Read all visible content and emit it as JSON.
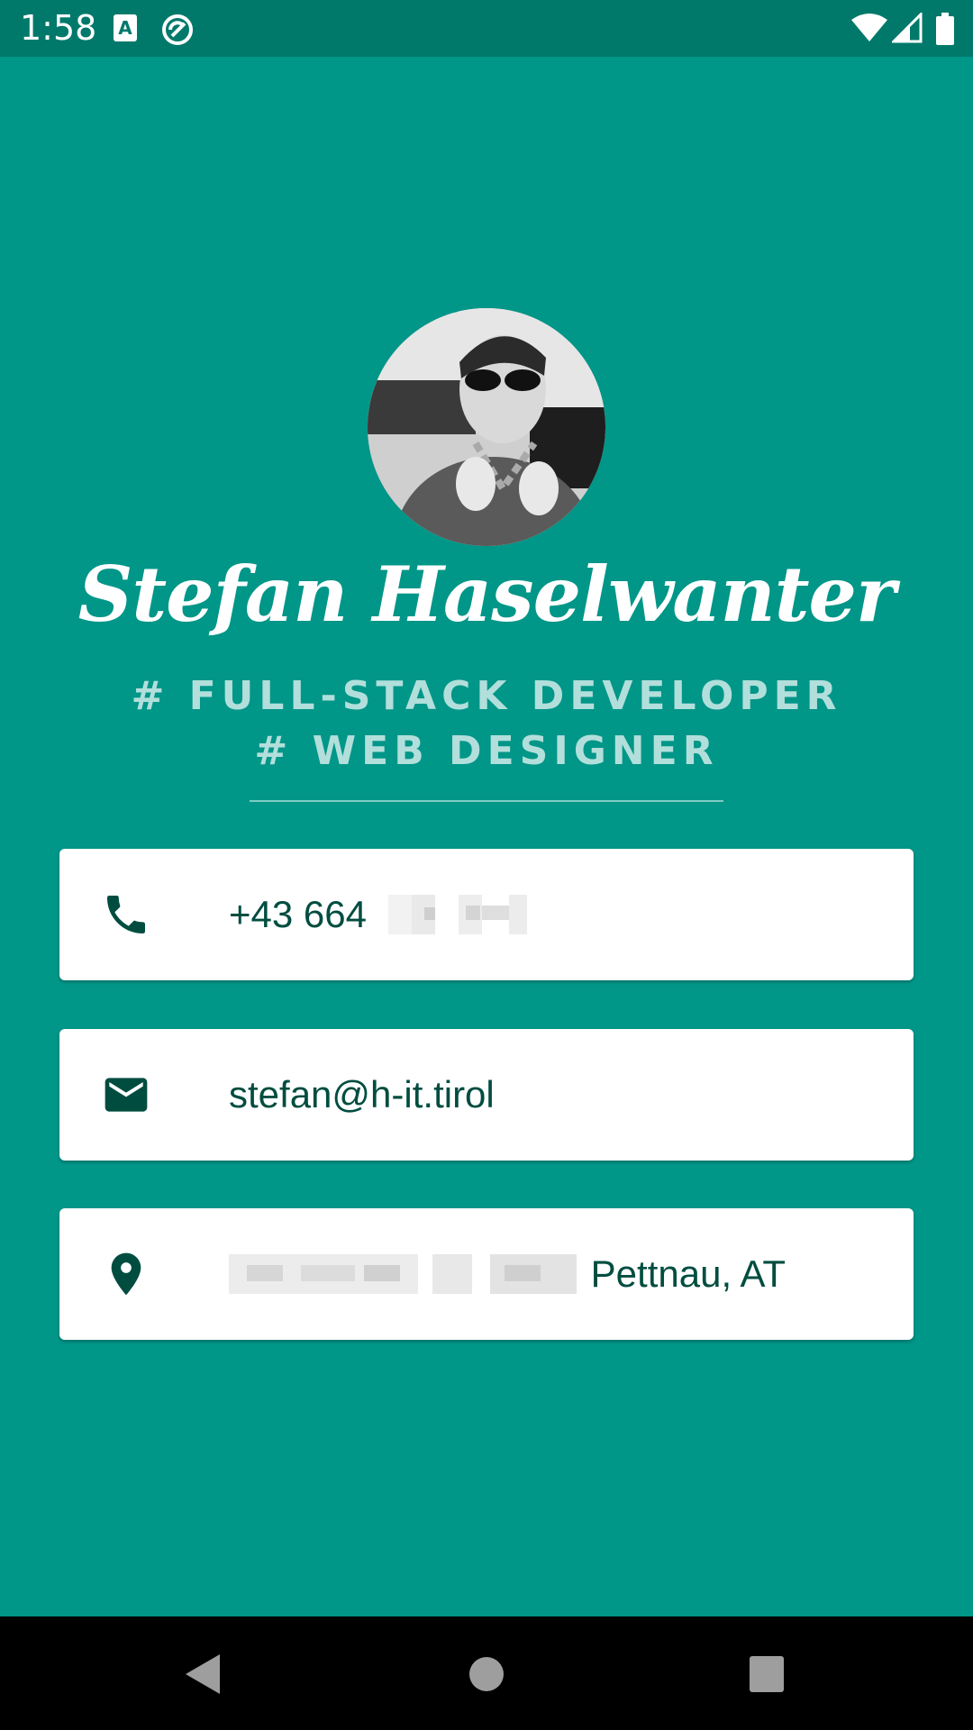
{
  "status_bar": {
    "time": "1:58",
    "icons": [
      "a-badge-icon",
      "sync-icon",
      "wifi-icon",
      "signal-icon",
      "battery-icon"
    ]
  },
  "profile": {
    "name": "Stefan Haselwanter",
    "roles": [
      "# FULL-STACK DEVELOPER",
      "# WEB DESIGNER"
    ]
  },
  "contacts": {
    "phone": {
      "icon": "phone-icon",
      "text": "+43 664"
    },
    "email": {
      "icon": "email-icon",
      "text": "stefan@h-it.tirol"
    },
    "location": {
      "icon": "location-pin-icon",
      "text": "Pettnau, AT"
    }
  },
  "nav_bar": {
    "icons": [
      "back-icon",
      "home-icon",
      "recents-icon"
    ]
  },
  "colors": {
    "background": "#009688",
    "status_bar": "#00796B",
    "role_text": "#B2DFDB",
    "card_text": "#004D40"
  }
}
